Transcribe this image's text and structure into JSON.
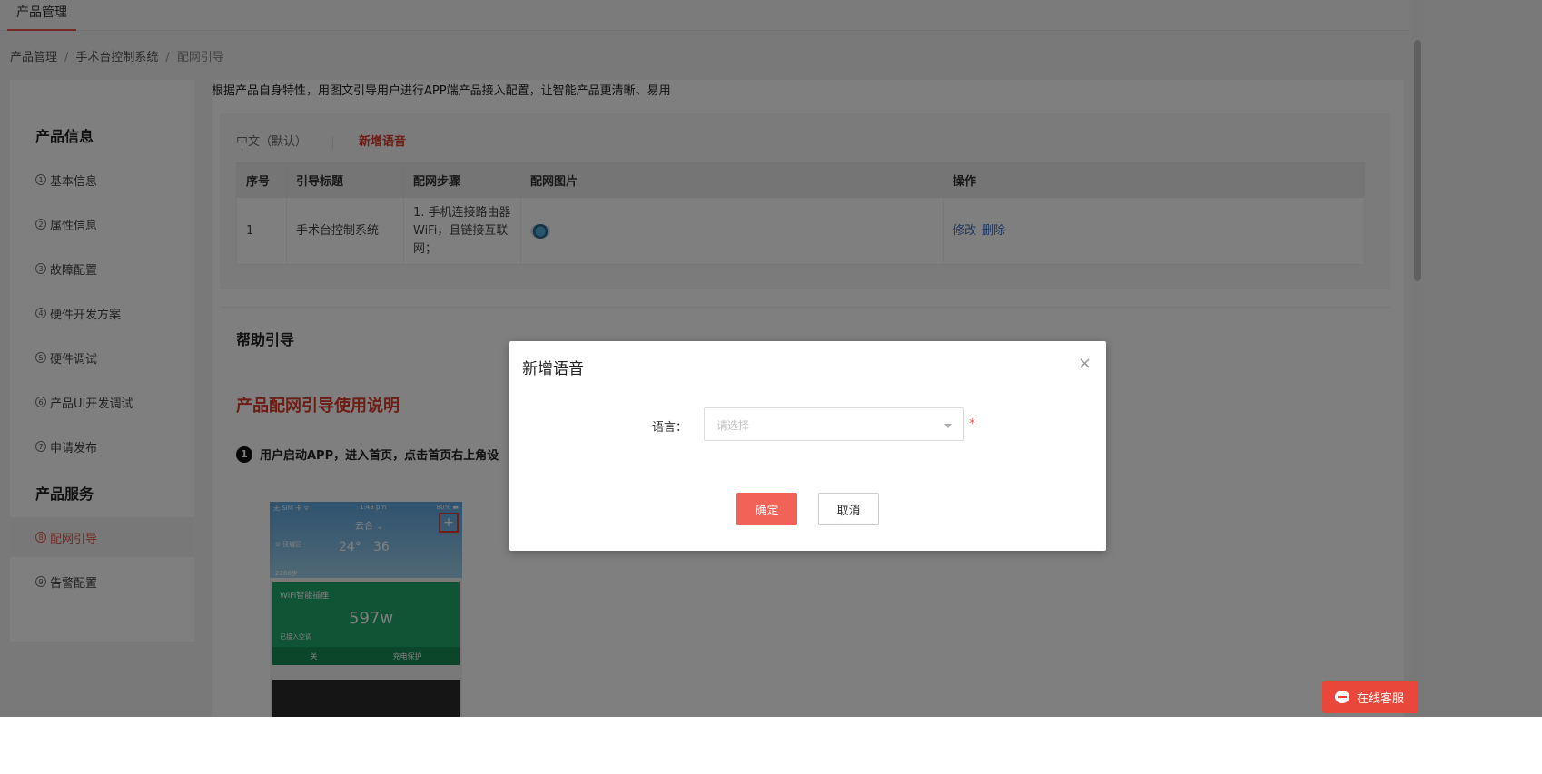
{
  "topbar": {
    "tab": "产品管理"
  },
  "breadcrumb": {
    "items": [
      "产品管理",
      "手术台控制系统",
      "配网引导"
    ],
    "sep": "/"
  },
  "sidebar": {
    "section1": "产品信息",
    "section2": "产品服务",
    "items": [
      {
        "num": "1",
        "label": "基本信息"
      },
      {
        "num": "2",
        "label": "属性信息"
      },
      {
        "num": "3",
        "label": "故障配置"
      },
      {
        "num": "4",
        "label": "硬件开发方案"
      },
      {
        "num": "5",
        "label": "硬件调试"
      },
      {
        "num": "6",
        "label": "产品UI开发调试"
      },
      {
        "num": "7",
        "label": "申请发布"
      },
      {
        "num": "8",
        "label": "配网引导"
      },
      {
        "num": "9",
        "label": "告警配置"
      }
    ]
  },
  "content": {
    "desc": "根据产品自身特性，用图文引导用户进行APP端产品接入配置，让智能产品更清晰、易用",
    "lang_default": "中文（默认）",
    "lang_add": "新增语音",
    "table": {
      "headers": [
        "序号",
        "引导标题",
        "配网步骤",
        "配网图片",
        "操作"
      ],
      "rows": [
        {
          "index": "1",
          "title": "手术台控制系统",
          "steps": "1. 手机连接路由器WiFi，且链接互联网；",
          "edit": "修改",
          "delete": "删除"
        }
      ]
    },
    "help_title": "帮助引导",
    "red_title": "产品配网引导使用说明",
    "step1_num": "1",
    "step1_text": "用户启动APP，进入首页，点击首页右上角设"
  },
  "phone": {
    "status_left": "无 SIM 卡 ᯤ",
    "status_time": "1:43 pm",
    "status_right": "80% ▬",
    "city": "云合 ⌄",
    "plus": "+",
    "location": "⊙ 径城区",
    "temp": "24°",
    "aqi": "36",
    "steps": "2266步",
    "card_title": "WiFi智能插座",
    "card_value": "597w",
    "card_label": "已接入空调",
    "card_btn1": "关",
    "card_btn2": "充电保护"
  },
  "modal": {
    "title": "新增语音",
    "close": "×",
    "label": "语言：",
    "placeholder": "请选择",
    "required": "*",
    "ok": "确定",
    "cancel": "取消"
  },
  "service": {
    "label": "在线客服"
  },
  "colors": {
    "accent": "#e8574a",
    "link": "#3a6cc0",
    "primary_button": "#f26257",
    "service": "#e8473a"
  }
}
